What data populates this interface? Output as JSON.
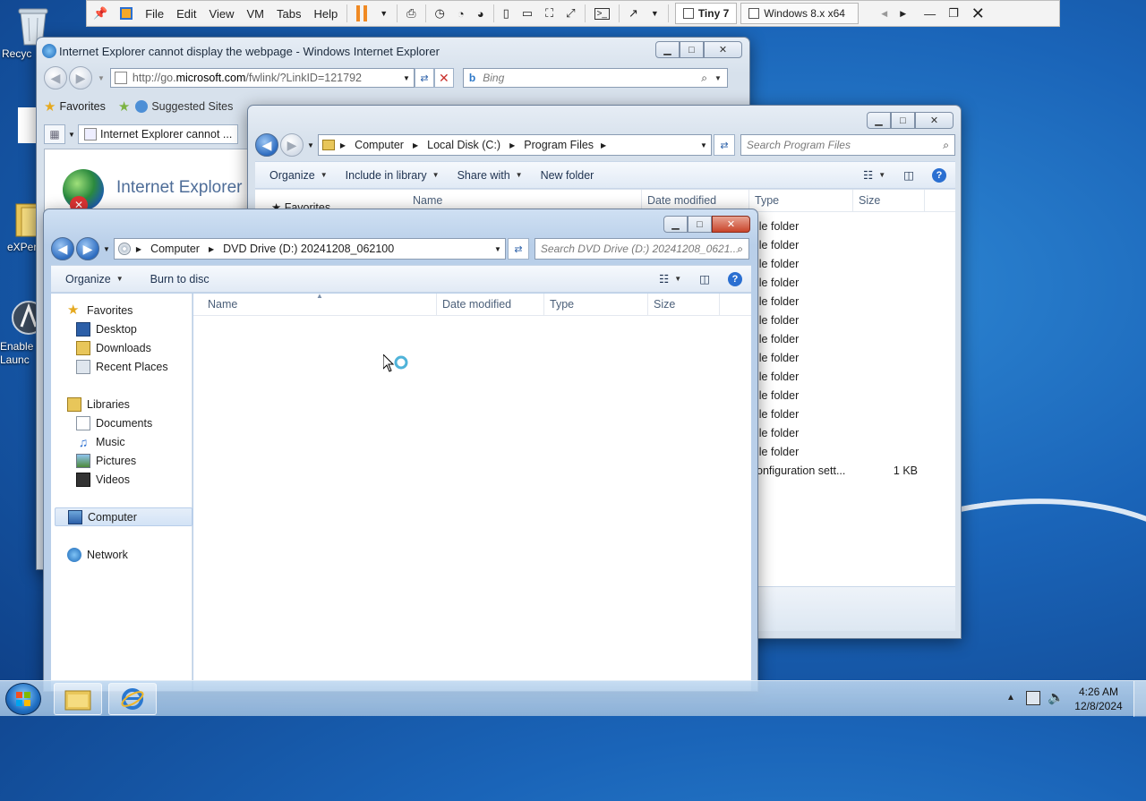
{
  "desktop": {
    "icons": [
      {
        "label": "Recyc"
      },
      {
        "label": "eXPer"
      },
      {
        "label": "Enable Launc"
      }
    ]
  },
  "vm_toolbar": {
    "menus": [
      "File",
      "Edit",
      "View",
      "VM",
      "Tabs",
      "Help"
    ],
    "tabs": [
      {
        "label": "Tiny 7",
        "active": true
      },
      {
        "label": "Windows 8.x x64",
        "active": false
      }
    ]
  },
  "ie_window": {
    "title": "Internet Explorer cannot display the webpage - Windows Internet Explorer",
    "url_prefix": "http://go.",
    "url_domain": "microsoft.com",
    "url_suffix": "/fwlink/?LinkID=121792",
    "search_placeholder": "Bing",
    "favorites_label": "Favorites",
    "suggested_sites": "Suggested Sites",
    "tab_title": "Internet Explorer cannot ...",
    "page_heading": "Internet Explorer ca"
  },
  "program_files_window": {
    "breadcrumb": [
      "Computer",
      "Local Disk (C:)",
      "Program Files"
    ],
    "search_placeholder": "Search Program Files",
    "commands": [
      "Organize",
      "Include in library",
      "Share with",
      "New folder"
    ],
    "columns": [
      "Name",
      "Date modified",
      "Type",
      "Size"
    ],
    "nav_partial": "Favorites",
    "rows": [
      {
        "type": "ile folder",
        "size": ""
      },
      {
        "type": "ile folder",
        "size": ""
      },
      {
        "type": "ile folder",
        "size": ""
      },
      {
        "type": "ile folder",
        "size": ""
      },
      {
        "type": "ile folder",
        "size": ""
      },
      {
        "type": "ile folder",
        "size": ""
      },
      {
        "type": "ile folder",
        "size": ""
      },
      {
        "type": "ile folder",
        "size": ""
      },
      {
        "type": "ile folder",
        "size": ""
      },
      {
        "type": "ile folder",
        "size": ""
      },
      {
        "type": "ile folder",
        "size": ""
      },
      {
        "type": "ile folder",
        "size": ""
      },
      {
        "type": "ile folder",
        "size": ""
      },
      {
        "type": "onfiguration sett...",
        "size": "1 KB"
      }
    ]
  },
  "dvd_window": {
    "breadcrumb": [
      "Computer",
      "DVD Drive (D:) 20241208_062100"
    ],
    "search_placeholder": "Search DVD Drive (D:) 20241208_0621...",
    "commands": [
      "Organize",
      "Burn to disc"
    ],
    "columns": [
      "Name",
      "Date modified",
      "Type",
      "Size"
    ],
    "nav": {
      "favorites": "Favorites",
      "desktop": "Desktop",
      "downloads": "Downloads",
      "recent": "Recent Places",
      "libraries": "Libraries",
      "documents": "Documents",
      "music": "Music",
      "pictures": "Pictures",
      "videos": "Videos",
      "computer": "Computer",
      "network": "Network"
    }
  },
  "taskbar": {
    "time": "4:26 AM",
    "date": "12/8/2024"
  },
  "colors": {
    "desktop_blue": "#1a64b8",
    "window_chrome": "#c3d5ea",
    "close_red": "#c9452b",
    "vm_pause_orange": "#f08a24"
  }
}
